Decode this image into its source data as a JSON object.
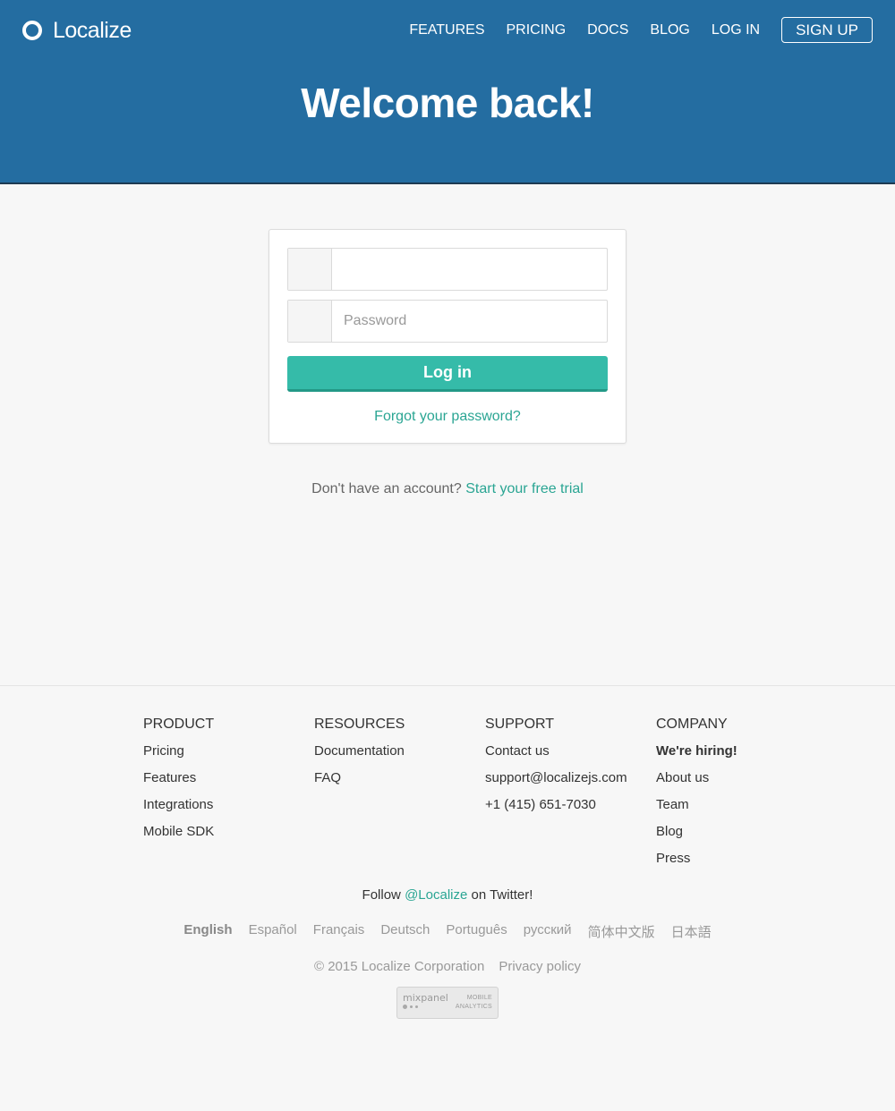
{
  "brand": {
    "name": "Localize"
  },
  "nav": {
    "items": [
      "FEATURES",
      "PRICING",
      "DOCS",
      "BLOG",
      "LOG IN"
    ],
    "signup_label": "SIGN UP"
  },
  "hero": {
    "title": "Welcome back!"
  },
  "login_form": {
    "email_value": "",
    "email_placeholder": "",
    "password_value": "",
    "password_placeholder": "Password",
    "submit_label": "Log in",
    "forgot_label": "Forgot your password?"
  },
  "signup_prompt": {
    "text": "Don't have an account?",
    "link": "Start your free trial"
  },
  "footer": {
    "columns": [
      {
        "heading": "PRODUCT",
        "items": [
          "Pricing",
          "Features",
          "Integrations",
          "Mobile SDK"
        ]
      },
      {
        "heading": "RESOURCES",
        "items": [
          "Documentation",
          "FAQ"
        ]
      },
      {
        "heading": "SUPPORT",
        "items": [
          "Contact us",
          "support@localizejs.com",
          "+1 (415) 651-7030"
        ]
      },
      {
        "heading": "COMPANY",
        "items": [
          "We're hiring!",
          "About us",
          "Team",
          "Blog",
          "Press"
        ]
      }
    ],
    "follow": {
      "prefix": "Follow",
      "handle": "@Localize",
      "suffix": "on Twitter!"
    },
    "languages": [
      "English",
      "Español",
      "Français",
      "Deutsch",
      "Português",
      "русский",
      "简体中文版",
      "日本語"
    ],
    "active_language": "English",
    "copyright": "© 2015 Localize Corporation",
    "privacy": "Privacy policy",
    "badge": {
      "brand": "mixpanel",
      "line1": "MOBILE",
      "line2": "ANALYTICS"
    }
  },
  "colors": {
    "header_bg": "#246da1",
    "accent": "#35bba9",
    "link": "#2aa593",
    "page_bg": "#f7f7f7"
  }
}
